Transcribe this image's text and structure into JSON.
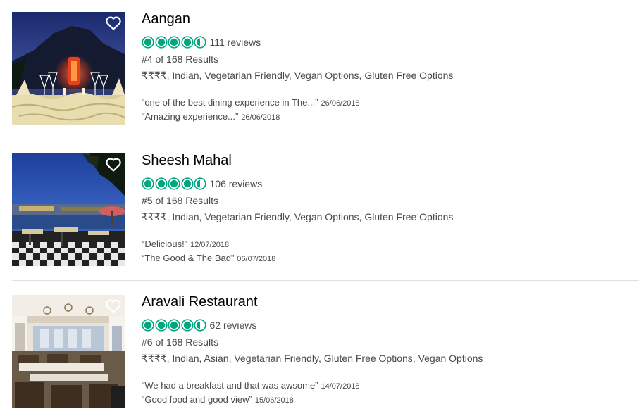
{
  "colors": {
    "bubble": "#00a680",
    "title": "#000000",
    "text": "#4a4a4a"
  },
  "listings": [
    {
      "name": "Aangan",
      "rating": 4.5,
      "reviews": "111 reviews",
      "rank": "#4 of 168 Results",
      "cuisines": "₹₹₹₹, Indian, Vegetarian Friendly, Vegan Options, Gluten Free Options",
      "snippets": [
        {
          "quote": "“one of the best dining experience in The...”",
          "date": "26/06/2018"
        },
        {
          "quote": "“Amazing experience...”",
          "date": "26/06/2018"
        }
      ]
    },
    {
      "name": "Sheesh Mahal",
      "rating": 4.5,
      "reviews": "106 reviews",
      "rank": "#5 of 168 Results",
      "cuisines": "₹₹₹₹, Indian, Vegetarian Friendly, Vegan Options, Gluten Free Options",
      "snippets": [
        {
          "quote": "“Delicious!”",
          "date": "12/07/2018"
        },
        {
          "quote": "“The Good & The Bad”",
          "date": "06/07/2018"
        }
      ]
    },
    {
      "name": "Aravali Restaurant",
      "rating": 4.5,
      "reviews": "62 reviews",
      "rank": "#6 of 168 Results",
      "cuisines": "₹₹₹₹, Indian, Asian, Vegetarian Friendly, Gluten Free Options, Vegan Options",
      "snippets": [
        {
          "quote": "“We had a breakfast and that was awsome”",
          "date": "14/07/2018"
        },
        {
          "quote": "“Good food and good view”",
          "date": "15/06/2018"
        }
      ]
    }
  ]
}
